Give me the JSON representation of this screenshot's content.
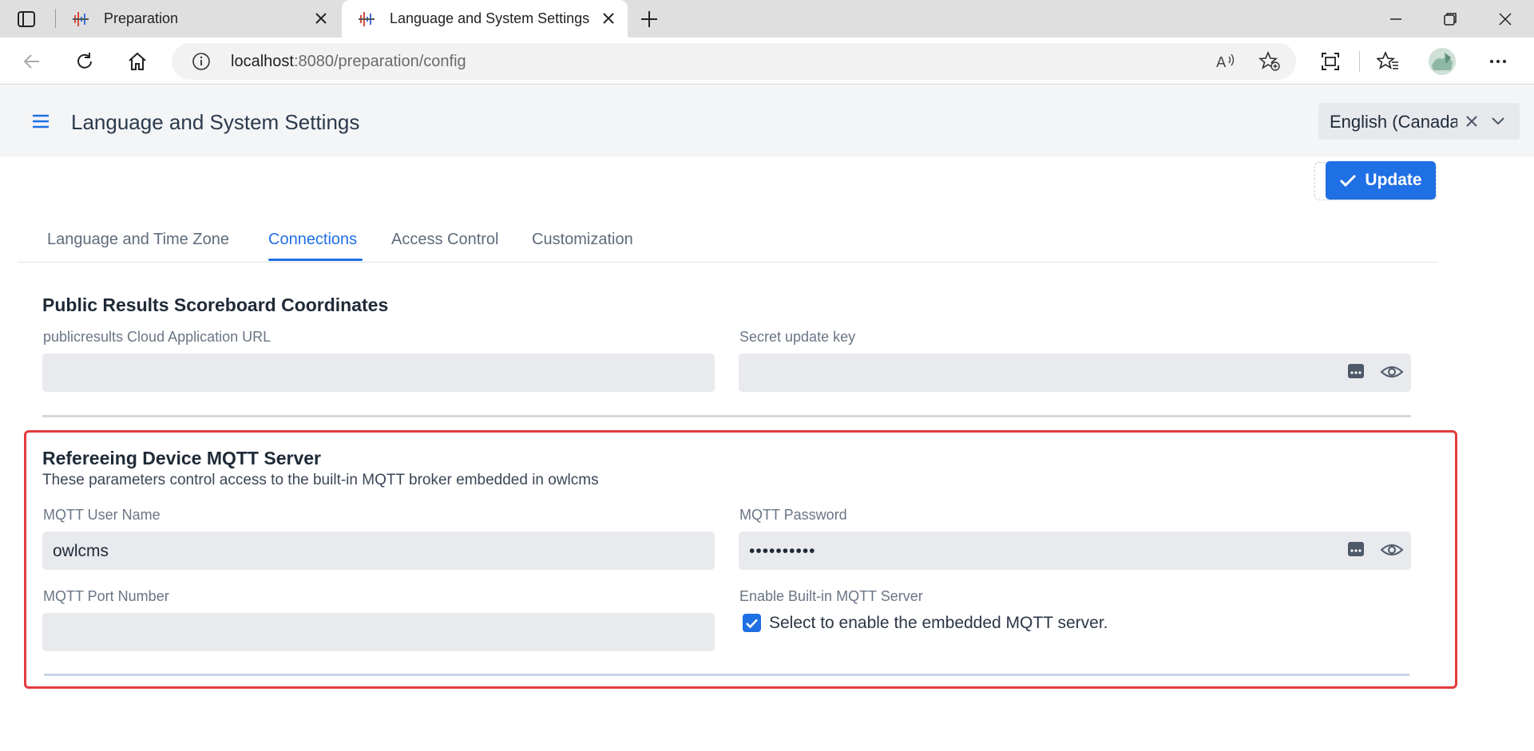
{
  "browser": {
    "tabs": [
      {
        "title": "Preparation",
        "active": false
      },
      {
        "title": "Language and System Settings",
        "active": true
      }
    ],
    "address": {
      "host": "localhost",
      "rest": ":8080/preparation/config"
    }
  },
  "app": {
    "title": "Language and System Settings",
    "language_select": {
      "value": "English (Canada)"
    },
    "update_label": "Update",
    "tabs": [
      "Language and Time Zone",
      "Connections",
      "Access Control",
      "Customization"
    ],
    "active_tab": "Connections"
  },
  "public_results": {
    "heading": "Public Results Scoreboard Coordinates",
    "url_label": "publicresults Cloud Application URL",
    "url_value": "",
    "key_label": "Secret update key",
    "key_value": ""
  },
  "mqtt": {
    "heading": "Refereeing Device MQTT Server",
    "description": "These parameters control access to the built-in MQTT broker embedded in owlcms",
    "user_label": "MQTT User Name",
    "user_value": "owlcms",
    "password_label": "MQTT Password",
    "password_value": "••••••••••",
    "port_label": "MQTT Port Number",
    "port_value": "",
    "enable_label": "Enable Built-in MQTT Server",
    "enable_checkbox_label": "Select to enable the embedded MQTT server.",
    "enable_checked": true
  },
  "colors": {
    "accent": "#1f6fe5",
    "highlight": "#e23b3b"
  }
}
